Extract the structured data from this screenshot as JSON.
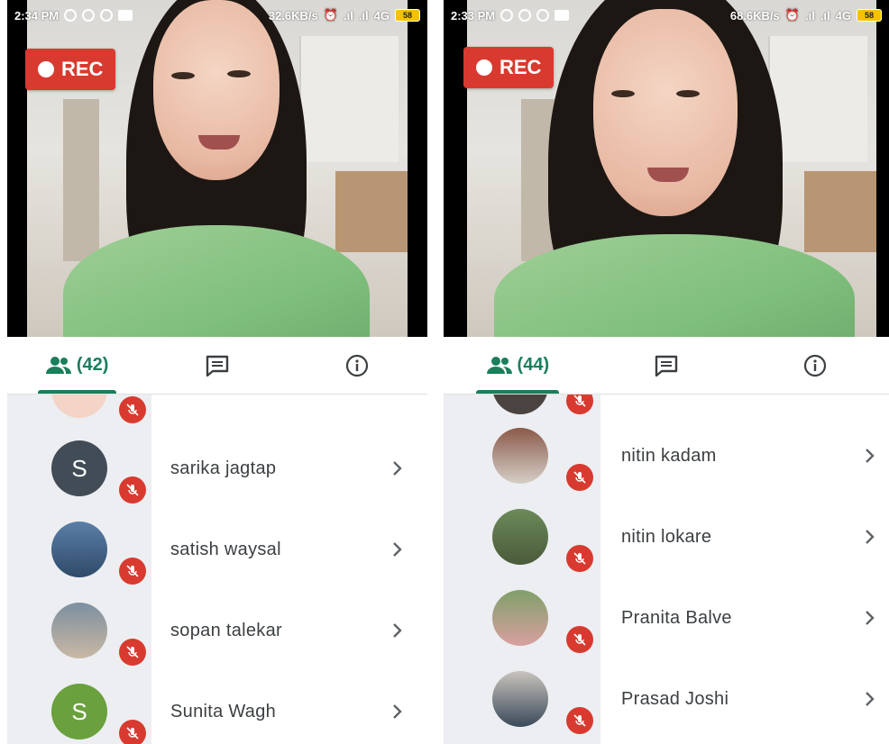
{
  "left": {
    "status": {
      "time": "2:34 PM",
      "speed": "32.6KB/s",
      "network": "4G",
      "battery": "58"
    },
    "rec_label": "REC",
    "tabs": {
      "people_count": "(42)"
    },
    "participants": [
      {
        "name": "",
        "avatar_color": "#f3d4c7",
        "avatar_letter": "",
        "photo": true
      },
      {
        "name": "sarika jagtap",
        "avatar_color": "#424c57",
        "avatar_letter": "S",
        "photo": false
      },
      {
        "name": "satish waysal",
        "avatar_color": "#5b7fa8",
        "avatar_letter": "",
        "photo": true
      },
      {
        "name": "sopan talekar",
        "avatar_color": "#7d8fa0",
        "avatar_letter": "",
        "photo": true
      },
      {
        "name": "Sunita Wagh",
        "avatar_color": "#6aa03d",
        "avatar_letter": "S",
        "photo": false
      }
    ]
  },
  "right": {
    "status": {
      "time": "2:33 PM",
      "speed": "68.6KB/s",
      "network": "4G",
      "battery": "58"
    },
    "rec_label": "REC",
    "tabs": {
      "people_count": "(44)"
    },
    "participants": [
      {
        "name": "",
        "avatar_color": "#4b4340",
        "avatar_letter": "",
        "photo": true
      },
      {
        "name": "nitin kadam",
        "avatar_color": "#8a5a4a",
        "avatar_letter": "",
        "photo": true
      },
      {
        "name": "nitin lokare",
        "avatar_color": "#6c8a5a",
        "avatar_letter": "",
        "photo": true
      },
      {
        "name": "Pranita Balve",
        "avatar_color": "#7fa06a",
        "avatar_letter": "",
        "photo": true
      },
      {
        "name": "Prasad Joshi",
        "avatar_color": "#c9c4bd",
        "avatar_letter": "",
        "photo": true
      }
    ]
  },
  "colors": {
    "accent": "#1a7f5b",
    "rec": "#d93a2f",
    "mute": "#d93a2f"
  }
}
